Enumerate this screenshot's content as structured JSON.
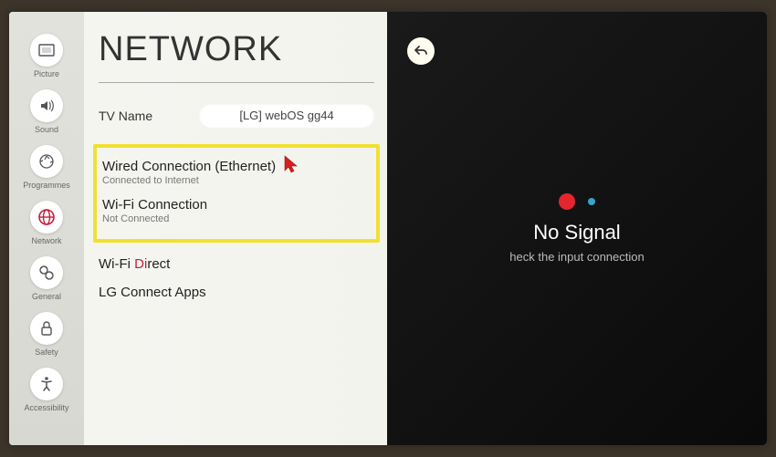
{
  "sidebar": {
    "items": [
      {
        "label": "Picture"
      },
      {
        "label": "Sound"
      },
      {
        "label": "Programmes"
      },
      {
        "label": "Network"
      },
      {
        "label": "General"
      },
      {
        "label": "Safety"
      },
      {
        "label": "Accessibility"
      }
    ]
  },
  "page": {
    "title": "NETWORK"
  },
  "tvname": {
    "label": "TV Name",
    "value": "[LG] webOS   gg44"
  },
  "options": {
    "wired": {
      "title": "Wired Connection (Ethernet)",
      "sub": "Connected to Internet"
    },
    "wifi": {
      "title": "Wi-Fi Connection",
      "sub": "Not Connected"
    },
    "wifidirect_pre": "Wi-Fi ",
    "wifidirect_accent": "Di",
    "wifidirect_post": "rect",
    "lgconnect": "LG Connect Apps"
  },
  "right": {
    "title": "No Signal",
    "sub": "heck the input connection"
  }
}
